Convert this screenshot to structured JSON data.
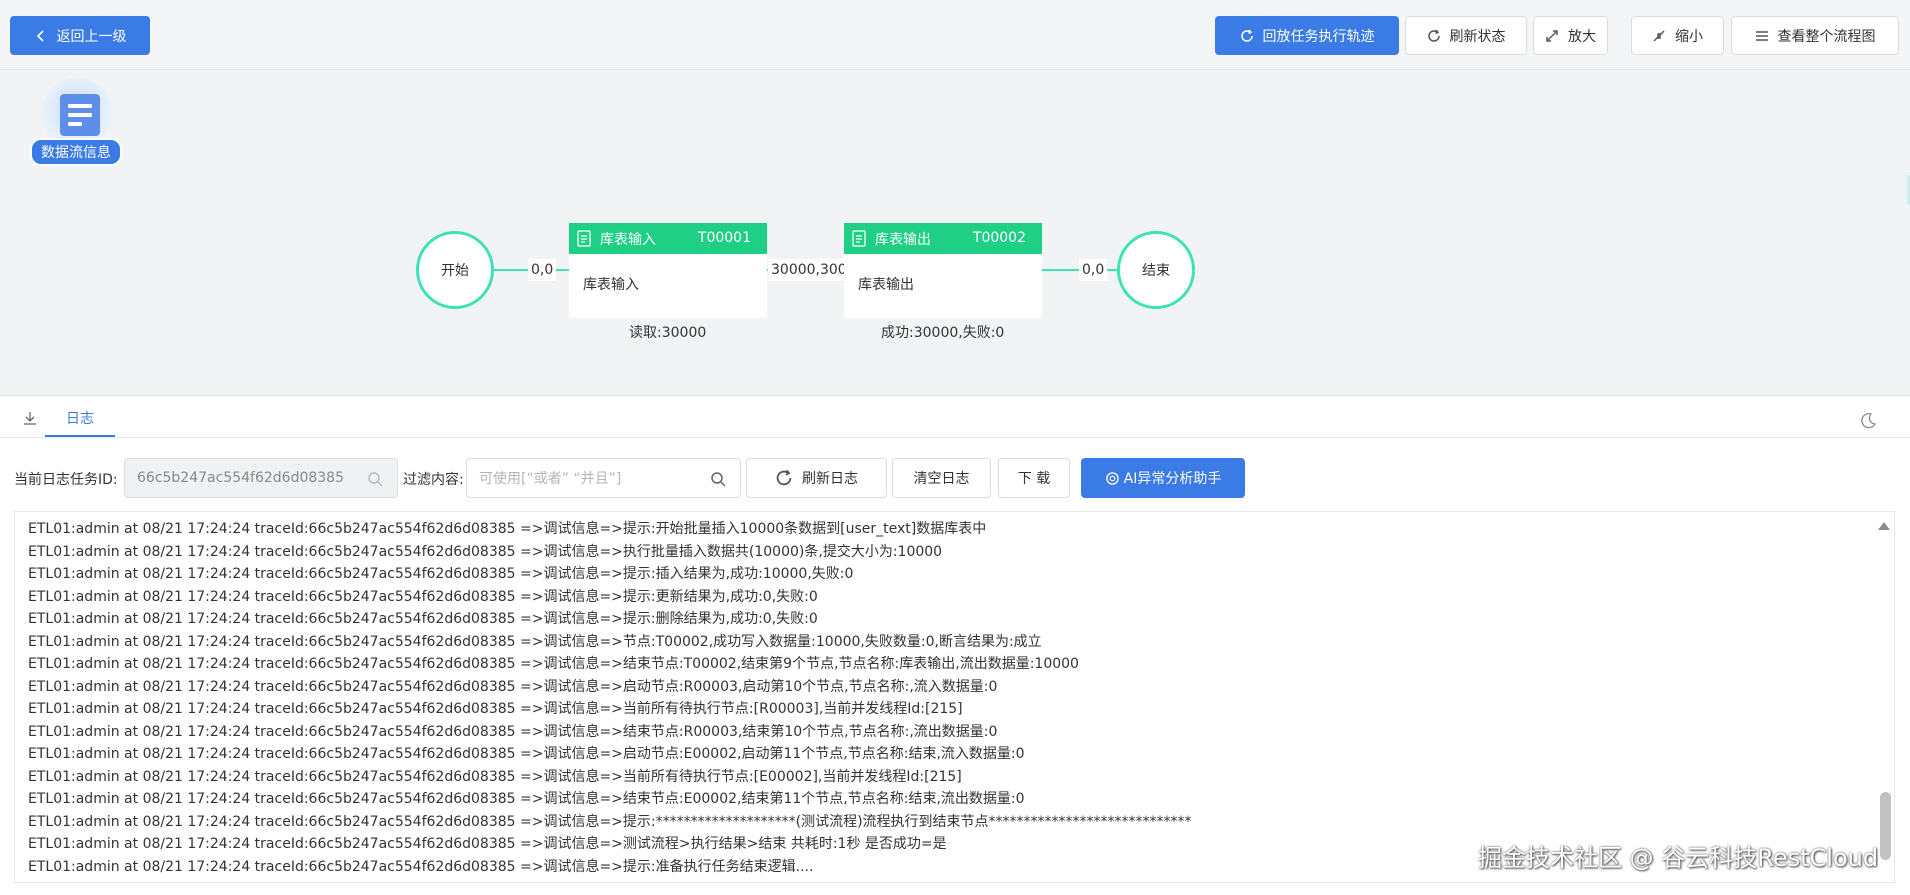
{
  "toolbar": {
    "back_label": "返回上一级",
    "replay_label": "回放任务执行轨迹",
    "refresh_label": "刷新状态",
    "zoom_in_label": "放大",
    "zoom_out_label": "缩小",
    "view_all_label": "查看整个流程图"
  },
  "canvas": {
    "dataflow_label": "数据流信息",
    "start_label": "开始",
    "end_label": "结束",
    "edges": [
      "0,0",
      "30000,300",
      "0,0"
    ],
    "nodes": [
      {
        "name": "库表输入",
        "id": "T00001",
        "body": "库表输入",
        "stat": "读取:30000"
      },
      {
        "name": "库表输出",
        "id": "T00002",
        "body": "库表输出",
        "stat": "成功:30000,失败:0"
      }
    ]
  },
  "tabs": {
    "log": "日志"
  },
  "filters": {
    "task_id_label": "当前日志任务ID:",
    "task_id_value": "66c5b247ac554f62d6d08385",
    "filter_label": "过滤内容:",
    "filter_placeholder": "可使用[“或者” “并且”]",
    "refresh_log": "刷新日志",
    "clear_log": "清空日志",
    "download": "下 载",
    "ai_helper": "AI异常分析助手"
  },
  "log_lines": [
    "ETL01:admin at 08/21 17:24:24 traceId:66c5b247ac554f62d6d08385 =>调试信息=>提示:开始批量插入10000条数据到[user_text]数据库表中",
    "ETL01:admin at 08/21 17:24:24 traceId:66c5b247ac554f62d6d08385 =>调试信息=>执行批量插入数据共(10000)条,提交大小为:10000",
    "ETL01:admin at 08/21 17:24:24 traceId:66c5b247ac554f62d6d08385 =>调试信息=>提示:插入结果为,成功:10000,失败:0",
    "ETL01:admin at 08/21 17:24:24 traceId:66c5b247ac554f62d6d08385 =>调试信息=>提示:更新结果为,成功:0,失败:0",
    "ETL01:admin at 08/21 17:24:24 traceId:66c5b247ac554f62d6d08385 =>调试信息=>提示:删除结果为,成功:0,失败:0",
    "ETL01:admin at 08/21 17:24:24 traceId:66c5b247ac554f62d6d08385 =>调试信息=>节点:T00002,成功写入数据量:10000,失败数量:0,断言结果为:成立",
    "ETL01:admin at 08/21 17:24:24 traceId:66c5b247ac554f62d6d08385 =>调试信息=>结束节点:T00002,结束第9个节点,节点名称:库表输出,流出数据量:10000",
    "ETL01:admin at 08/21 17:24:24 traceId:66c5b247ac554f62d6d08385 =>调试信息=>启动节点:R00003,启动第10个节点,节点名称:,流入数据量:0",
    "ETL01:admin at 08/21 17:24:24 traceId:66c5b247ac554f62d6d08385 =>调试信息=>当前所有待执行节点:[R00003],当前并发线程Id:[215]",
    "ETL01:admin at 08/21 17:24:24 traceId:66c5b247ac554f62d6d08385 =>调试信息=>结束节点:R00003,结束第10个节点,节点名称:,流出数据量:0",
    "ETL01:admin at 08/21 17:24:24 traceId:66c5b247ac554f62d6d08385 =>调试信息=>启动节点:E00002,启动第11个节点,节点名称:结束,流入数据量:0",
    "ETL01:admin at 08/21 17:24:24 traceId:66c5b247ac554f62d6d08385 =>调试信息=>当前所有待执行节点:[E00002],当前并发线程Id:[215]",
    "ETL01:admin at 08/21 17:24:24 traceId:66c5b247ac554f62d6d08385 =>调试信息=>结束节点:E00002,结束第11个节点,节点名称:结束,流出数据量:0",
    "ETL01:admin at 08/21 17:24:24 traceId:66c5b247ac554f62d6d08385 =>调试信息=>提示:********************(测试流程)流程执行到结束节点*****************************",
    "ETL01:admin at 08/21 17:24:24 traceId:66c5b247ac554f62d6d08385 =>调试信息=>测试流程>执行结果>结束 共耗时:1秒 是否成功=是",
    "ETL01:admin at 08/21 17:24:24 traceId:66c5b247ac554f62d6d08385 =>调试信息=>提示:准备执行任务结束逻辑...."
  ],
  "watermark": "掘金技术社区 @ 谷云科技RestCloud"
}
